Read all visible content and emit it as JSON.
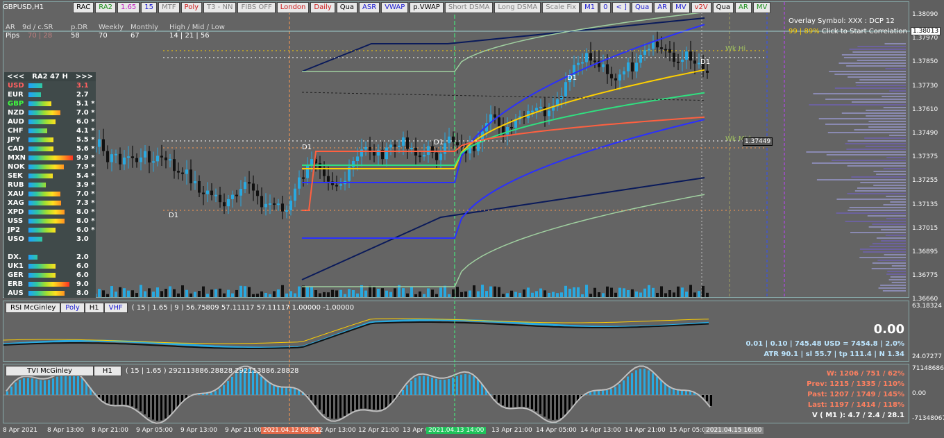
{
  "window": {
    "symbol": "GBPUSD,H1"
  },
  "toolbar": [
    {
      "label": "RAC",
      "color": "#000000"
    },
    {
      "label": "RA2",
      "color": "#1a8f1a"
    },
    {
      "label": "1.65",
      "color": "#c01ec0"
    },
    {
      "label": "15",
      "color": "#1a1ad0"
    },
    {
      "label": "MTF",
      "color": "#808080"
    },
    {
      "label": "Poly",
      "color": "#d01a1a"
    },
    {
      "label": "T3 - NN",
      "color": "#808080"
    },
    {
      "label": "FIBS OFF",
      "color": "#808080"
    },
    {
      "label": "London",
      "color": "#d01a1a"
    },
    {
      "label": "Daily",
      "color": "#d01a1a"
    },
    {
      "label": "Qua",
      "color": "#000000"
    },
    {
      "label": "ASR",
      "color": "#1a1ad0"
    },
    {
      "label": "VWAP",
      "color": "#1a1ad0"
    },
    {
      "label": "p.VWAP",
      "color": "#000000"
    },
    {
      "label": "Short DSMA",
      "color": "#808080"
    },
    {
      "label": "Long DSMA",
      "color": "#808080"
    },
    {
      "label": "Scale Fix",
      "color": "#808080"
    },
    {
      "label": "M1",
      "color": "#1a1ad0"
    },
    {
      "label": "0",
      "color": "#1a1ad0"
    },
    {
      "label": "< ]",
      "color": "#1a1ad0"
    },
    {
      "label": "Qua",
      "color": "#1a1ad0"
    },
    {
      "label": "AR",
      "color": "#1a1ad0"
    },
    {
      "label": "MV",
      "color": "#1a1ad0"
    },
    {
      "label": "v2V",
      "color": "#d01a1a"
    },
    {
      "label": "Qua",
      "color": "#000000"
    },
    {
      "label": "AR",
      "color": "#1a8f1a"
    },
    {
      "label": "MV",
      "color": "#1a8f1a"
    }
  ],
  "ranges": {
    "labels": [
      "AR",
      "9d / c.SR",
      "p.DR",
      "Weekly",
      "Monthly",
      "High / Mid / Low"
    ],
    "pips_label": "Pips",
    "pips": [
      "70 | 28",
      "58",
      "70",
      "67",
      "14 | 21 | 56"
    ]
  },
  "strength": {
    "prev": "<<<",
    "title": "RA2 47 H",
    "next": ">>>",
    "items": [
      {
        "name": "USD",
        "value": "3.1",
        "nameColor": "#ff6060",
        "bar": 3.1
      },
      {
        "name": "EUR",
        "value": "2.7",
        "nameColor": "#ffffff",
        "bar": 2.7
      },
      {
        "name": "GBP",
        "value": "5.1 *",
        "nameColor": "#40ff40",
        "bar": 5.1
      },
      {
        "name": "NZD",
        "value": "7.0 *",
        "nameColor": "#ffffff",
        "bar": 7.0
      },
      {
        "name": "AUD",
        "value": "6.0 *",
        "nameColor": "#ffffff",
        "bar": 6.0
      },
      {
        "name": "CHF",
        "value": "4.1 *",
        "nameColor": "#ffffff",
        "bar": 4.1
      },
      {
        "name": "JPY",
        "value": "5.5 *",
        "nameColor": "#ffffff",
        "bar": 5.5
      },
      {
        "name": "CAD",
        "value": "5.6 *",
        "nameColor": "#ffffff",
        "bar": 5.6
      },
      {
        "name": "MXN",
        "value": "9.9 *",
        "nameColor": "#ffffff",
        "bar": 9.9
      },
      {
        "name": "NOK",
        "value": "7.9 *",
        "nameColor": "#ffffff",
        "bar": 7.9
      },
      {
        "name": "SEK",
        "value": "5.4 *",
        "nameColor": "#ffffff",
        "bar": 5.4
      },
      {
        "name": "RUB",
        "value": "3.9 *",
        "nameColor": "#ffffff",
        "bar": 3.9
      },
      {
        "name": "XAU",
        "value": "7.0 *",
        "nameColor": "#ffffff",
        "bar": 7.0
      },
      {
        "name": "XAG",
        "value": "7.3 *",
        "nameColor": "#ffffff",
        "bar": 7.3
      },
      {
        "name": "XPD",
        "value": "8.0 *",
        "nameColor": "#ffffff",
        "bar": 8.0
      },
      {
        "name": "USS",
        "value": "8.0 *",
        "nameColor": "#ffffff",
        "bar": 8.0
      },
      {
        "name": "JP2",
        "value": "6.0 *",
        "nameColor": "#ffffff",
        "bar": 6.0
      },
      {
        "name": "USO",
        "value": "3.0",
        "nameColor": "#ffffff",
        "bar": 3.0
      },
      {
        "name": "",
        "value": "",
        "nameColor": "#ffffff",
        "bar": 0
      },
      {
        "name": "DX.",
        "value": "2.0",
        "nameColor": "#ffffff",
        "bar": 2.0
      },
      {
        "name": "UK1",
        "value": "6.0",
        "nameColor": "#ffffff",
        "bar": 6.0
      },
      {
        "name": "GER",
        "value": "6.0",
        "nameColor": "#ffffff",
        "bar": 6.0
      },
      {
        "name": "ERB",
        "value": "9.0",
        "nameColor": "#ffffff",
        "bar": 9.0
      },
      {
        "name": "AUS",
        "value": "8.0",
        "nameColor": "#ffffff",
        "bar": 8.0
      }
    ]
  },
  "overlay": {
    "symbol_text": "Overlay Symbol: XXX : DCP 12",
    "corr_pct": "99 | 89%",
    "corr_text": "Click to Start Correlation"
  },
  "price_axis": [
    "1.38090",
    "1.37970",
    "1.37850",
    "1.37730",
    "1.37610",
    "1.37490",
    "1.37375",
    "1.37255",
    "1.37135",
    "1.37015",
    "1.36895",
    "1.36775",
    "1.36660"
  ],
  "current_price": "1.38013",
  "level_tag": "1.37449",
  "labels": {
    "wk_hi": "Wk Hi",
    "wk_mid": "Wk Mid",
    "d1": "D1"
  },
  "rsi": {
    "name": "RSI McGinley",
    "btn2": "Poly",
    "btn3": "H1",
    "btn4": "VHF",
    "params": "( 15 | 1.65 | 9 ) 56.75809 57.11117 57.11117 1.00000 -1.00000",
    "axis_top": "63.18324",
    "axis_bottom": "24.07277",
    "big_value": "0.00",
    "line1": "0.01  |  0.10  |  745.48 USD = 7454.8  |  2.0%",
    "line2": "ATR 90.1  |  sl 55.7  |  tp 111.4  |  N 1.34"
  },
  "tvi": {
    "name": "TVI McGinley",
    "btn2": "H1",
    "params": "( 15 | 1.65 ) 292113886.28828 292113886.28828",
    "axis_top": "71148686",
    "axis_mid": "0.00",
    "axis_bottom": "-71348067",
    "w": "W: 1206 / 751 / 62%",
    "prev": "Prev: 1215 / 1335 / 110%",
    "past": "Past: 1207 / 1749 / 145%",
    "last": "Last: 1197 / 1414 / 118%",
    "v": "V ( M1 ): 4.7 / 2.4 / 28.1"
  },
  "time_axis": [
    {
      "label": "8 Apr 2021",
      "style": ""
    },
    {
      "label": "8 Apr 13:00",
      "style": ""
    },
    {
      "label": "8 Apr 21:00",
      "style": ""
    },
    {
      "label": "9 Apr 05:00",
      "style": ""
    },
    {
      "label": "9 Apr 13:00",
      "style": ""
    },
    {
      "label": "9 Apr 21:00",
      "style": ""
    },
    {
      "label": "2021.04.12 08:00",
      "style": "o"
    },
    {
      "label": "12 Apr 13:00",
      "style": ""
    },
    {
      "label": "12 Apr 21:00",
      "style": ""
    },
    {
      "label": "13 Apr 05:00",
      "style": ""
    },
    {
      "label": "2021.04.13 14:00",
      "style": "g"
    },
    {
      "label": "13 Apr 21:00",
      "style": ""
    },
    {
      "label": "14 Apr 05:00",
      "style": ""
    },
    {
      "label": "14 Apr 13:00",
      "style": ""
    },
    {
      "label": "14 Apr 21:00",
      "style": ""
    },
    {
      "label": "15 Apr 05:00",
      "style": ""
    },
    {
      "label": "2021.04.15 16:00",
      "style": "b"
    }
  ]
}
